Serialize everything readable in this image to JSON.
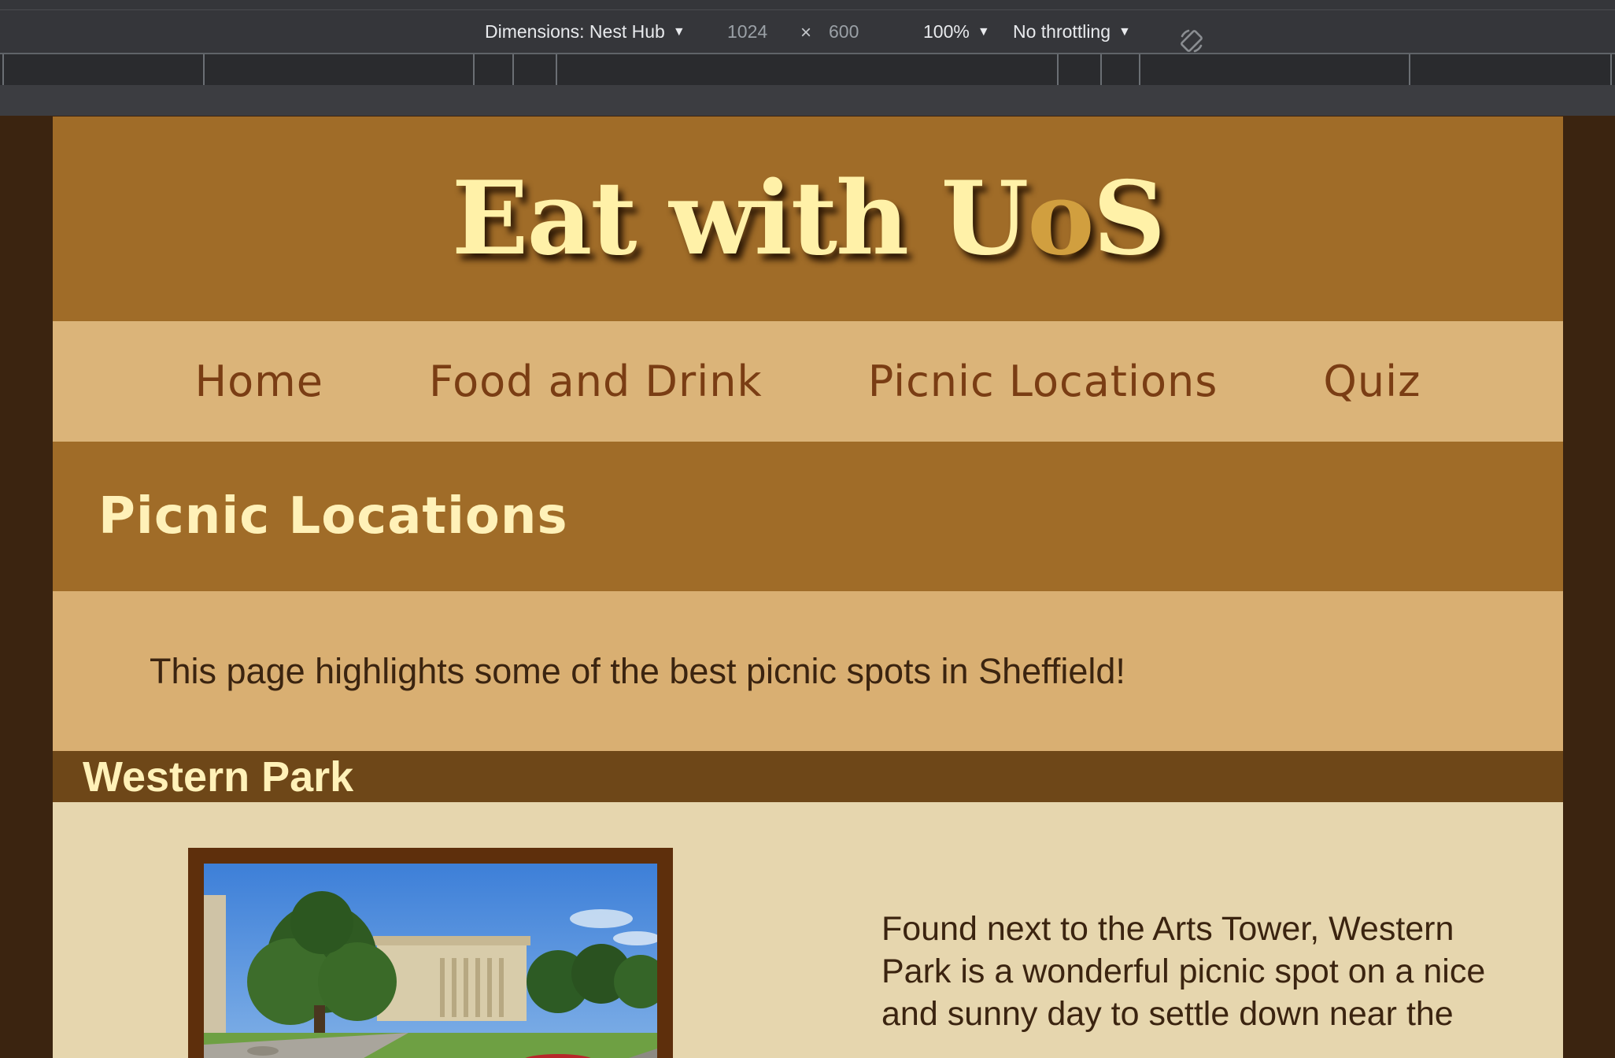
{
  "devtools": {
    "dimensions_label": "Dimensions: Nest Hub",
    "width": "1024",
    "times": "×",
    "height": "600",
    "zoom": "100%",
    "throttling": "No throttling",
    "rotate_icon": "rotate-icon"
  },
  "site": {
    "title_main": "Eat with U",
    "title_highlight": "o",
    "title_end": "S",
    "colors": {
      "header": "#a06c28",
      "nav": "#dbb479",
      "title": "#fff1a8",
      "highlight": "#d19f3f"
    }
  },
  "nav": {
    "items": [
      "Home",
      "Food and Drink",
      "Picnic Locations",
      "Quiz"
    ]
  },
  "page": {
    "heading": "Picnic Locations",
    "intro": "This page highlights some of the best picnic spots in Sheffield!"
  },
  "sections": [
    {
      "title": "Western Park",
      "image": "park-photo",
      "text": "Found next to the Arts Tower, Western Park is a wonderful picnic spot on a nice and sunny day to settle down near the"
    }
  ]
}
